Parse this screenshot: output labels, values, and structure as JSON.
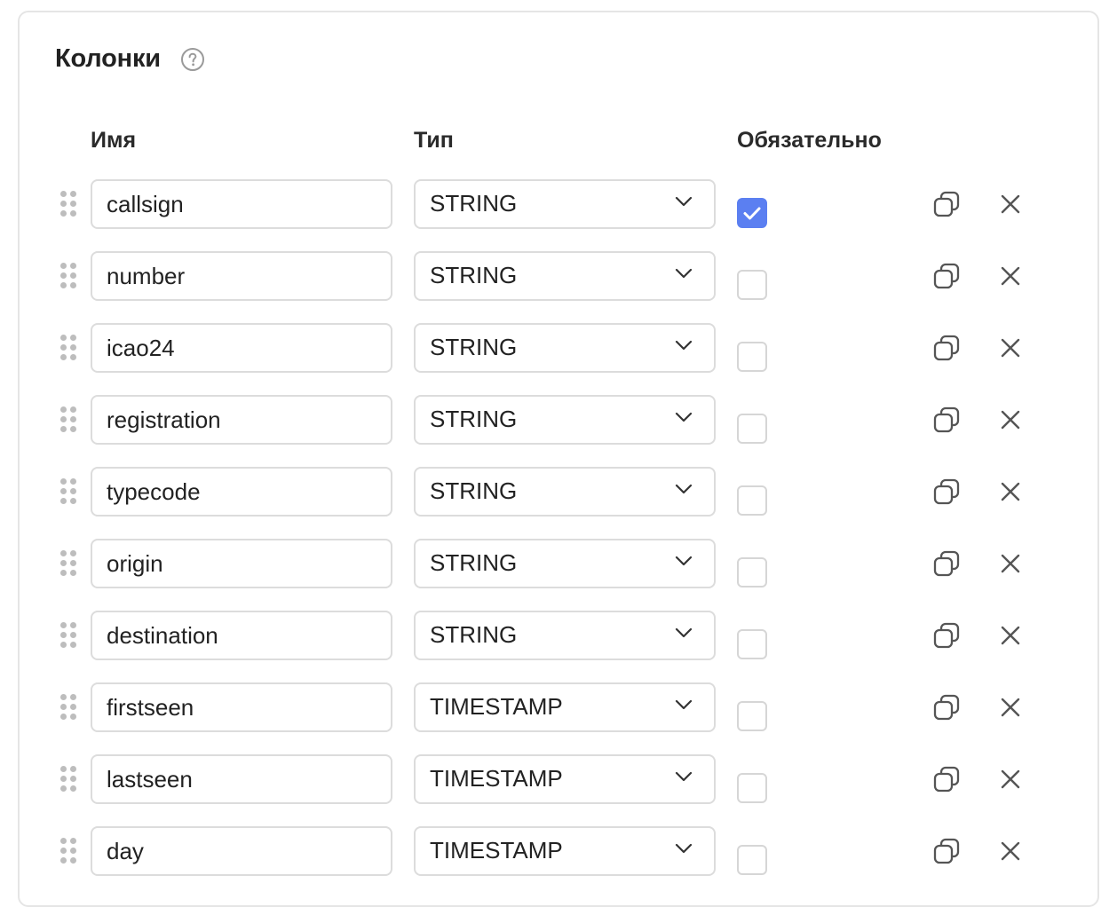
{
  "section": {
    "title": "Колонки",
    "help_icon": "question-circle-icon"
  },
  "headers": {
    "name": "Имя",
    "type": "Тип",
    "required": "Обязательно"
  },
  "colors": {
    "checkbox_checked": "#5b7ff1",
    "border": "#dcdcdc",
    "icon": "#6f6f6f"
  },
  "columns": [
    {
      "name": "callsign",
      "type": "STRING",
      "required": true
    },
    {
      "name": "number",
      "type": "STRING",
      "required": false
    },
    {
      "name": "icao24",
      "type": "STRING",
      "required": false
    },
    {
      "name": "registration",
      "type": "STRING",
      "required": false
    },
    {
      "name": "typecode",
      "type": "STRING",
      "required": false
    },
    {
      "name": "origin",
      "type": "STRING",
      "required": false
    },
    {
      "name": "destination",
      "type": "STRING",
      "required": false
    },
    {
      "name": "firstseen",
      "type": "TIMESTAMP",
      "required": false
    },
    {
      "name": "lastseen",
      "type": "TIMESTAMP",
      "required": false
    },
    {
      "name": "day",
      "type": "TIMESTAMP",
      "required": false
    }
  ],
  "row_icons": {
    "drag": "drag-handle-icon",
    "type_dropdown": "chevron-down-icon",
    "copy": "copy-icon",
    "delete": "close-icon"
  }
}
